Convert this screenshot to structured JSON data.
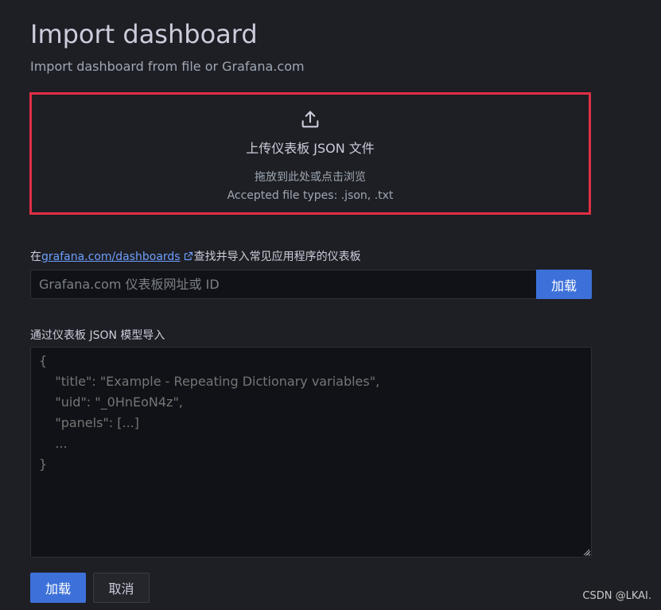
{
  "page": {
    "title": "Import dashboard",
    "subtitle": "Import dashboard from file or Grafana.com"
  },
  "upload": {
    "icon": "upload-icon",
    "title": "上传仪表板 JSON 文件",
    "hint": "拖放到此处或点击浏览",
    "accepted_types": "Accepted file types: .json, .txt"
  },
  "gcom": {
    "label_prefix": "在",
    "link_text": "grafana.com/dashboards",
    "label_suffix": "查找并导入常见应用程序的仪表板",
    "placeholder": "Grafana.com 仪表板网址或 ID",
    "value": "",
    "load_button": "加载"
  },
  "json_model": {
    "label": "通过仪表板 JSON 模型导入",
    "placeholder": "{\n    \"title\": \"Example - Repeating Dictionary variables\",\n    \"uid\": \"_0HnEoN4z\",\n    \"panels\": [...]\n    ...\n}",
    "value": ""
  },
  "actions": {
    "load_button": "加载",
    "cancel_button": "取消"
  },
  "watermark": "CSDN @LKAI."
}
